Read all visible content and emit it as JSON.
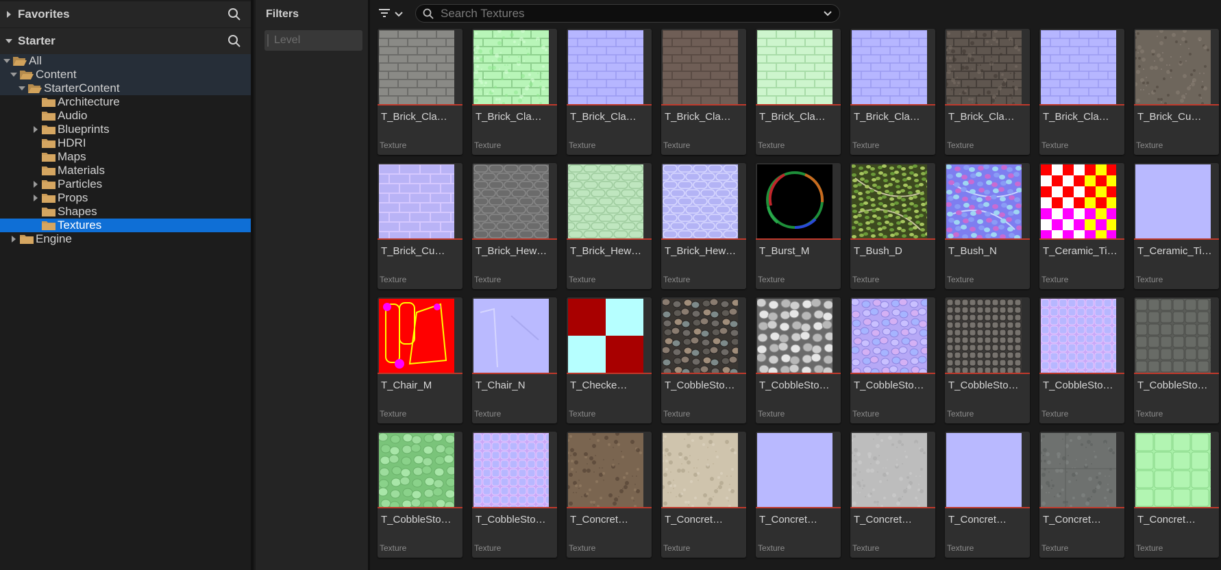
{
  "favorites": {
    "label": "Favorites"
  },
  "starter": {
    "label": "Starter"
  },
  "tree": [
    {
      "label": "All",
      "depth": 0,
      "expand": "down",
      "open": true,
      "hl": true
    },
    {
      "label": "Content",
      "depth": 1,
      "expand": "down",
      "open": true,
      "hl": true
    },
    {
      "label": "StarterContent",
      "depth": 2,
      "expand": "down",
      "open": true,
      "hl": true
    },
    {
      "label": "Architecture",
      "depth": 3,
      "expand": "none",
      "open": false
    },
    {
      "label": "Audio",
      "depth": 3,
      "expand": "none",
      "open": false
    },
    {
      "label": "Blueprints",
      "depth": 3,
      "expand": "right",
      "open": false
    },
    {
      "label": "HDRI",
      "depth": 3,
      "expand": "none",
      "open": false
    },
    {
      "label": "Maps",
      "depth": 3,
      "expand": "none",
      "open": false
    },
    {
      "label": "Materials",
      "depth": 3,
      "expand": "none",
      "open": false
    },
    {
      "label": "Particles",
      "depth": 3,
      "expand": "right",
      "open": false
    },
    {
      "label": "Props",
      "depth": 3,
      "expand": "right",
      "open": false
    },
    {
      "label": "Shapes",
      "depth": 3,
      "expand": "none",
      "open": false
    },
    {
      "label": "Textures",
      "depth": 3,
      "expand": "none",
      "open": false,
      "selected": true
    },
    {
      "label": "Engine",
      "depth": 1,
      "expand": "right",
      "open": false
    }
  ],
  "filters": {
    "title": "Filters",
    "level_placeholder": "Level"
  },
  "search": {
    "placeholder": "Search Textures"
  },
  "assets": [
    {
      "name": "T_Brick_Cla…",
      "type": "Texture",
      "thumb": "brick-gray"
    },
    {
      "name": "T_Brick_Cla…",
      "type": "Texture",
      "thumb": "brick-green"
    },
    {
      "name": "T_Brick_Cla…",
      "type": "Texture",
      "thumb": "brick-normal"
    },
    {
      "name": "T_Brick_Cla…",
      "type": "Texture",
      "thumb": "brick-brown"
    },
    {
      "name": "T_Brick_Cla…",
      "type": "Texture",
      "thumb": "brick-lightgreen"
    },
    {
      "name": "T_Brick_Cla…",
      "type": "Texture",
      "thumb": "brick-normal"
    },
    {
      "name": "T_Brick_Cla…",
      "type": "Texture",
      "thumb": "brick-dark"
    },
    {
      "name": "T_Brick_Cla…",
      "type": "Texture",
      "thumb": "brick-normal"
    },
    {
      "name": "T_Brick_Cu…",
      "type": "Texture",
      "thumb": "stone-rough"
    },
    {
      "name": "T_Brick_Cu…",
      "type": "Texture",
      "thumb": "brick-normal-soft"
    },
    {
      "name": "T_Brick_Hew…",
      "type": "Texture",
      "thumb": "hewn-gray"
    },
    {
      "name": "T_Brick_Hew…",
      "type": "Texture",
      "thumb": "hewn-green"
    },
    {
      "name": "T_Brick_Hew…",
      "type": "Texture",
      "thumb": "hewn-normal"
    },
    {
      "name": "T_Burst_M",
      "type": "Texture",
      "thumb": "burst"
    },
    {
      "name": "T_Bush_D",
      "type": "Texture",
      "thumb": "bush-d"
    },
    {
      "name": "T_Bush_N",
      "type": "Texture",
      "thumb": "bush-n"
    },
    {
      "name": "T_Ceramic_Ti…",
      "type": "Texture",
      "thumb": "ceramic-checker"
    },
    {
      "name": "T_Ceramic_Ti…",
      "type": "Texture",
      "thumb": "flat-normal"
    },
    {
      "name": "T_Chair_M",
      "type": "Texture",
      "thumb": "chair-m"
    },
    {
      "name": "T_Chair_N",
      "type": "Texture",
      "thumb": "chair-n"
    },
    {
      "name": "T_Checke…",
      "type": "Texture",
      "thumb": "checker"
    },
    {
      "name": "T_CobbleSto…",
      "type": "Texture",
      "thumb": "cobble-color"
    },
    {
      "name": "T_CobbleSto…",
      "type": "Texture",
      "thumb": "cobble-gray"
    },
    {
      "name": "T_CobbleSto…",
      "type": "Texture",
      "thumb": "cobble-normal"
    },
    {
      "name": "T_CobbleSto…",
      "type": "Texture",
      "thumb": "cobble-square"
    },
    {
      "name": "T_CobbleSto…",
      "type": "Texture",
      "thumb": "cobble-square-normal"
    },
    {
      "name": "T_CobbleSto…",
      "type": "Texture",
      "thumb": "cobble-dark"
    },
    {
      "name": "T_CobbleSto…",
      "type": "Texture",
      "thumb": "cobble-green"
    },
    {
      "name": "T_CobbleSto…",
      "type": "Texture",
      "thumb": "cobble-square-normal"
    },
    {
      "name": "T_Concret…",
      "type": "Texture",
      "thumb": "concrete-brown"
    },
    {
      "name": "T_Concret…",
      "type": "Texture",
      "thumb": "concrete-beige"
    },
    {
      "name": "T_Concret…",
      "type": "Texture",
      "thumb": "flat-normal"
    },
    {
      "name": "T_Concret…",
      "type": "Texture",
      "thumb": "concrete-light"
    },
    {
      "name": "T_Concret…",
      "type": "Texture",
      "thumb": "flat-normal"
    },
    {
      "name": "T_Concret…",
      "type": "Texture",
      "thumb": "concrete-gray"
    },
    {
      "name": "T_Concret…",
      "type": "Texture",
      "thumb": "concrete-green"
    }
  ]
}
